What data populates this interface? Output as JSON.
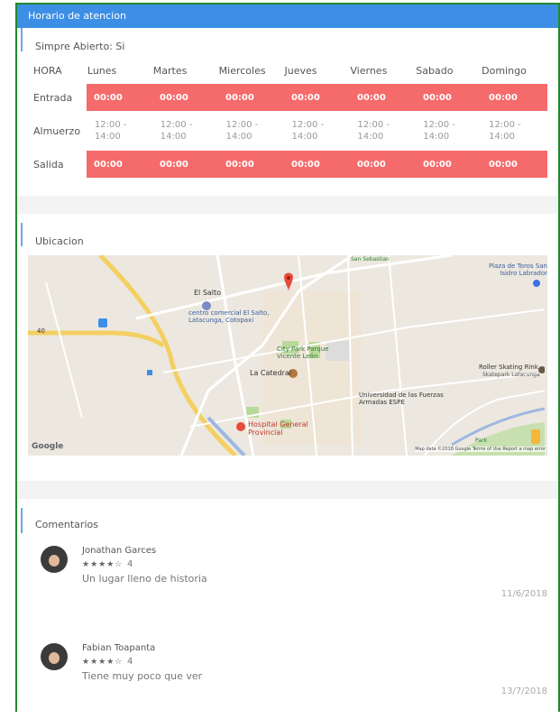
{
  "header": {
    "title": "Horario de atencion"
  },
  "status": {
    "always_open": "Simpre Abierto: Si"
  },
  "schedule": {
    "hour_label": "HORA",
    "days": [
      "Lunes",
      "Martes",
      "Miercoles",
      "Jueves",
      "Viernes",
      "Sabado",
      "Domingo"
    ],
    "entrada": {
      "label": "Entrada",
      "values": [
        "00:00",
        "00:00",
        "00:00",
        "00:00",
        "00:00",
        "00:00",
        "00:00"
      ]
    },
    "almuerzo": {
      "label": "Almuerzo",
      "values": [
        "12:00 - 14:00",
        "12:00 - 14:00",
        "12:00 - 14:00",
        "12:00 - 14:00",
        "12:00 - 14:00",
        "12:00 - 14:00",
        "12:00 - 14:00"
      ]
    },
    "salida": {
      "label": "Salida",
      "values": [
        "00:00",
        "00:00",
        "00:00",
        "00:00",
        "00:00",
        "00:00",
        "00:00"
      ]
    }
  },
  "location": {
    "title": "Ubicacion",
    "map_labels": {
      "el_salto": "El Salto",
      "centro_comercial": "centro comercial El Salto, Latacunga, Cotopaxi",
      "city_park": "City Park Parque Vicente León",
      "catedral": "La Catedral",
      "hospital": "Hospital General Provincial",
      "universidad": "Universidad de las Fuerzas Armadas ESPE",
      "plaza_toros": "Plaza de Toros San Isidro Labrador",
      "roller": "Roller Skating Rink",
      "skatepark": "Skatepark Latacunga",
      "san_sebastian": "San Sebastian",
      "park": "Park",
      "route": "40",
      "google": "Google",
      "footer": "Map data ©2018 Google   Terms of Use   Report a map error"
    },
    "colors": {
      "marker": "#e74c3c"
    }
  },
  "comments": {
    "title": "Comentarios",
    "items": [
      {
        "name": "Jonathan Garces",
        "stars": "★★★★☆",
        "rating": "4",
        "text": "Un lugar lleno de historia",
        "date": "11/6/2018"
      },
      {
        "name": "Fabian Toapanta",
        "stars": "★★★★☆",
        "rating": "4",
        "text": "Tiene muy poco que ver",
        "date": "13/7/2018"
      }
    ]
  }
}
